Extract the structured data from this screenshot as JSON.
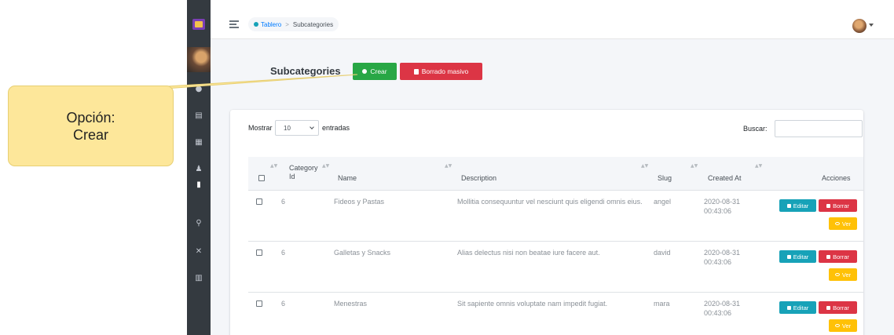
{
  "breadcrumb": {
    "home": "Tablero",
    "separator": ">",
    "current": "Subcategories"
  },
  "page": {
    "title": "Subcategories",
    "create_label": "Crear",
    "bulk_delete_label": "Borrado masivo"
  },
  "table_controls": {
    "show_label": "Mostrar",
    "page_length": "10",
    "entries_label": "entradas",
    "search_label": "Buscar:",
    "search_value": ""
  },
  "table": {
    "headers": {
      "category_id_line1": "Category",
      "category_id_line2": "Id",
      "name": "Name",
      "description": "Description",
      "slug": "Slug",
      "created_at": "Created At",
      "actions": "Acciones"
    },
    "rows": [
      {
        "category_id": "6",
        "name": "Fideos y Pastas",
        "description": "Mollitia consequuntur vel nesciunt quis eligendi omnis eius.",
        "slug": "angel",
        "created_date": "2020-08-31",
        "created_time": "00:43:06"
      },
      {
        "category_id": "6",
        "name": "Galletas y Snacks",
        "description": "Alias delectus nisi non beatae iure facere aut.",
        "slug": "david",
        "created_date": "2020-08-31",
        "created_time": "00:43:06"
      },
      {
        "category_id": "6",
        "name": "Menestras",
        "description": "Sit sapiente omnis voluptate nam impedit fugiat.",
        "slug": "mara",
        "created_date": "2020-08-31",
        "created_time": "00:43:06"
      }
    ],
    "actions": {
      "edit": "Editar",
      "delete": "Borrar",
      "view": "Ver"
    }
  },
  "callout": {
    "line1": "Opción:",
    "line2": "Crear"
  },
  "colors": {
    "sidebar": "#343a40",
    "success": "#28a745",
    "danger": "#dc3545",
    "info": "#17a2b8",
    "warning": "#ffc107",
    "callout": "#fde79a"
  },
  "icons": [
    "menu-icon",
    "home-icon",
    "user-avatar",
    "chevron-down-icon",
    "circle-plus-icon",
    "trash-icon",
    "edit-icon",
    "eye-icon"
  ]
}
